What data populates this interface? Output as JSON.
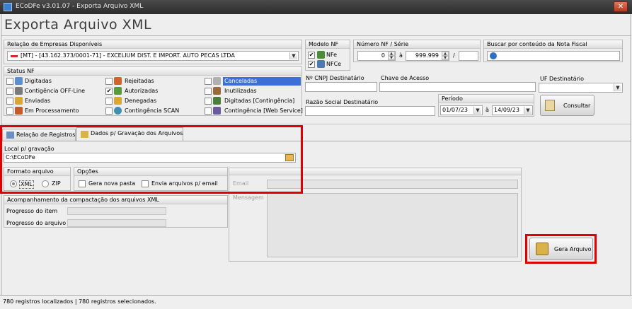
{
  "window": {
    "title": "ECoDFe v3.01.07 - Exporta Arquivo XML",
    "close_glyph": "✕"
  },
  "page_title": "Exporta Arquivo XML",
  "empresas": {
    "label": "Relação de Empresas Disponíveis",
    "selected": "[MT] - [43.162.373/0001-71] - EXCELIUM DIST. E IMPORT. AUTO PECAS LTDA"
  },
  "modelo_nf": {
    "label": "Modelo NF",
    "options": [
      {
        "label": "NFe",
        "checked": true
      },
      {
        "label": "NFCe",
        "checked": true
      }
    ]
  },
  "numero_nf": {
    "label": "Número NF / Série",
    "from": "0",
    "sep": "à",
    "to": "999.999",
    "serie_sep": "/",
    "serie": ""
  },
  "busca_conteudo": {
    "label": "Buscar por conteúdo da Nota Fiscal",
    "value": ""
  },
  "status_nf": {
    "label": "Status NF",
    "col1": [
      {
        "label": "Digitadas",
        "checked": false,
        "icon": "document-icon"
      },
      {
        "label": "Contigência OFF-Line",
        "checked": false,
        "icon": "offline-icon"
      },
      {
        "label": "Enviadas",
        "checked": false,
        "icon": "send-icon"
      },
      {
        "label": "Em Processamento",
        "checked": false,
        "icon": "processing-icon"
      }
    ],
    "col2": [
      {
        "label": "Rejeitadas",
        "checked": false,
        "icon": "rejected-icon"
      },
      {
        "label": "Autorizadas",
        "checked": true,
        "icon": "authorized-icon"
      },
      {
        "label": "Denegadas",
        "checked": false,
        "icon": "denied-icon"
      },
      {
        "label": "Contingência SCAN",
        "checked": false,
        "icon": "scan-icon"
      }
    ],
    "col3": [
      {
        "label": "Canceladas",
        "checked": false,
        "icon": "cancelled-icon",
        "highlighted": true
      },
      {
        "label": "Inutilizadas",
        "checked": false,
        "icon": "unused-icon"
      },
      {
        "label": "Digitadas [Contingência]",
        "checked": false,
        "icon": "typed-contingency-icon"
      },
      {
        "label": "Contingência [Web Service]",
        "checked": false,
        "icon": "webservice-icon"
      }
    ]
  },
  "cnpj_destinatario": {
    "label": "Nº CNPJ Destinatário",
    "value": ""
  },
  "chave_acesso": {
    "label": "Chave de Acesso",
    "value": ""
  },
  "uf_destinatario": {
    "label": "UF Destinatário",
    "value": ""
  },
  "razao_social": {
    "label": "Razão Social Destinatário",
    "value": ""
  },
  "periodo": {
    "label": "Período",
    "from": "01/07/23",
    "sep": "à",
    "to": "14/09/23"
  },
  "consultar_label": "Consultar",
  "tabs": [
    {
      "label": "Relação de Registros",
      "active": false
    },
    {
      "label": "Dados p/ Gravação dos Arquivos",
      "active": true
    }
  ],
  "local_gravacao": {
    "label": "Local p/ gravação",
    "value": "C:\\ECoDFe"
  },
  "formato_arquivo": {
    "label": "Formato arquivo",
    "options": [
      {
        "label": "XML",
        "selected": true
      },
      {
        "label": "ZIP",
        "selected": false
      }
    ]
  },
  "opcoes": {
    "label": "Opções",
    "gera_nova_pasta": "Gera nova pasta",
    "envia_email": "Envia arquivos p/ email"
  },
  "email_label": "Email",
  "mensagem_label": "Mensagem",
  "acompanhamento": {
    "label": "Acompanhamento da compactação dos arquivos XML",
    "progresso_item": "Progresso do item",
    "progresso_arquivo": "Progresso do arquivo"
  },
  "gera_arquivo_label": "Gera Arquivo",
  "status_bar": "780 registros localizados | 780 registros selecionados.",
  "colors": {
    "highlight": "#3d6fd8",
    "annotation_red": "#e10000"
  }
}
